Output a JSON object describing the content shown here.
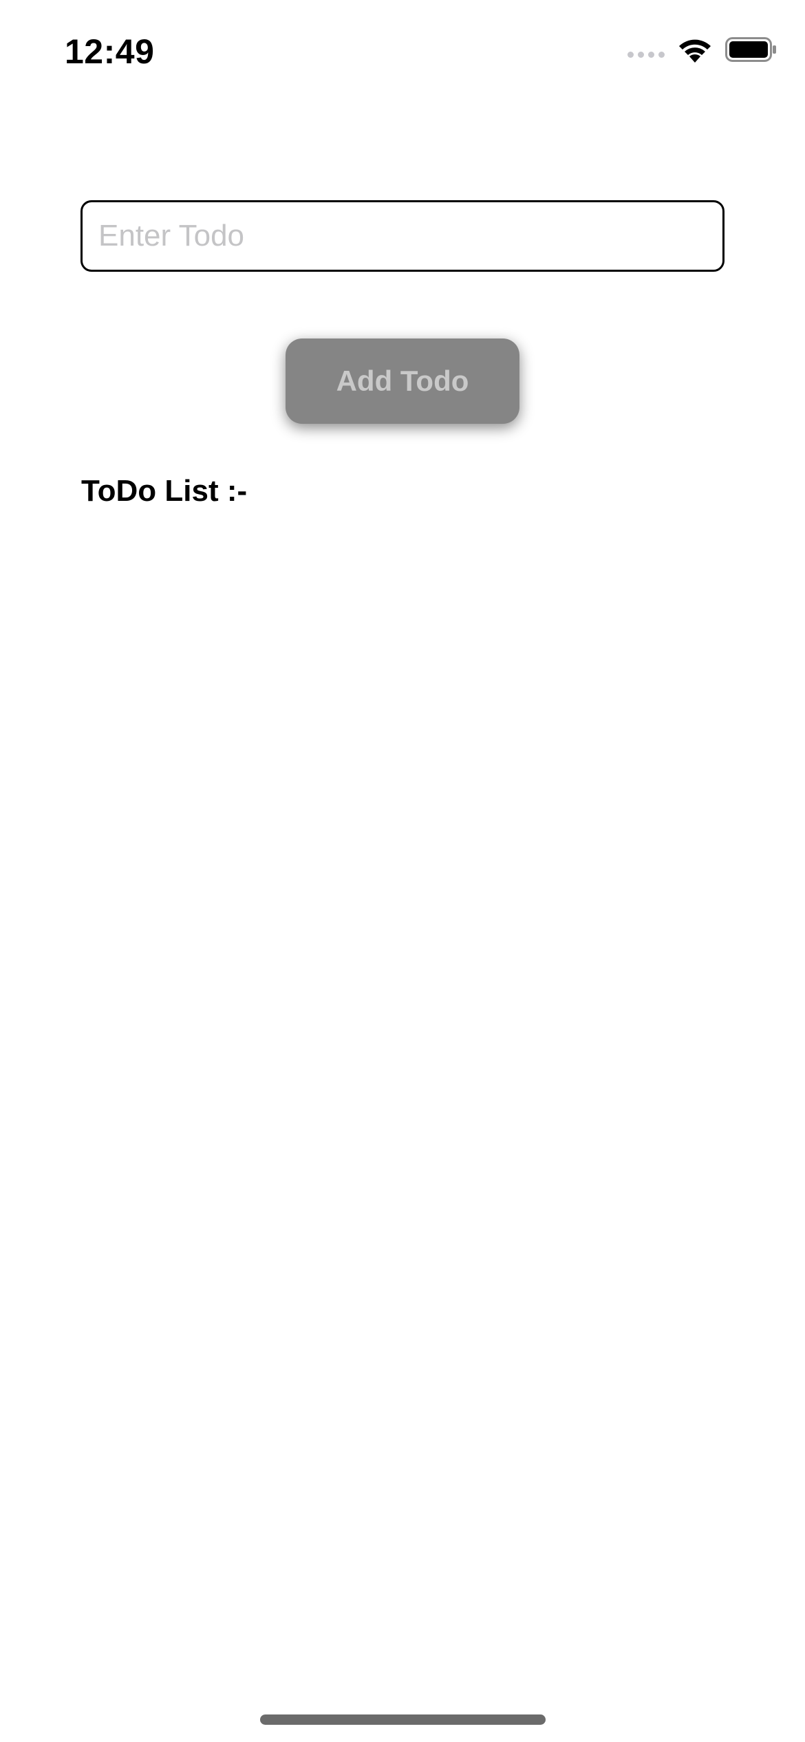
{
  "status_bar": {
    "time": "12:49",
    "icons": [
      "cellular-signal-icon",
      "wifi-icon",
      "battery-icon"
    ]
  },
  "todo_form": {
    "input_value": "",
    "input_placeholder": "Enter Todo",
    "add_button_label": "Add Todo"
  },
  "todo_list": {
    "heading": "ToDo List :-",
    "items": []
  },
  "colors": {
    "button_background": "#858585",
    "button_text": "#c9c9c9",
    "placeholder_text": "#c4c4c6",
    "input_border": "#000000"
  }
}
